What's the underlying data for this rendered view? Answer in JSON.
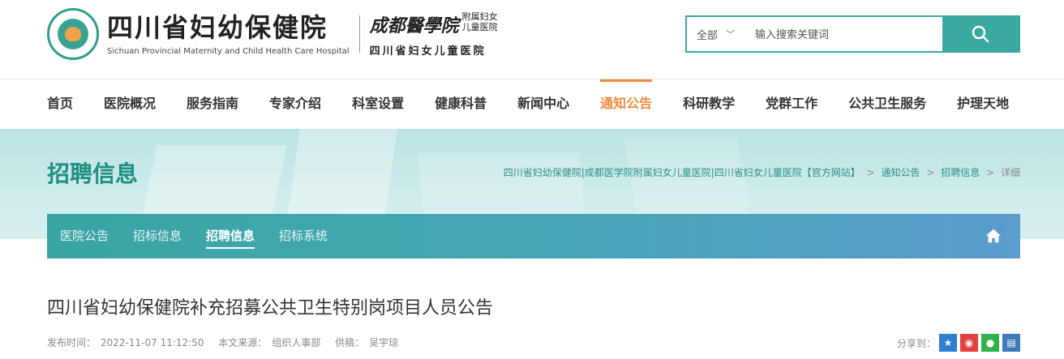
{
  "header": {
    "title_cn": "四川省妇幼保健院",
    "title_en": "Sichuan Provincial Maternity and Child Health Care Hospital",
    "affiliate_script": "成都醫學院",
    "affiliate_small_1": "附属妇女",
    "affiliate_small_2": "儿童医院",
    "affiliate_name": "四川省妇女儿童医院"
  },
  "search": {
    "scope": "全部",
    "placeholder": "输入搜索关键词"
  },
  "nav": {
    "items": [
      {
        "label": "首页"
      },
      {
        "label": "医院概况"
      },
      {
        "label": "服务指南"
      },
      {
        "label": "专家介绍"
      },
      {
        "label": "科室设置"
      },
      {
        "label": "健康科普"
      },
      {
        "label": "新闻中心"
      },
      {
        "label": "通知公告"
      },
      {
        "label": "科研教学"
      },
      {
        "label": "党群工作"
      },
      {
        "label": "公共卫生服务"
      },
      {
        "label": "护理天地"
      }
    ],
    "active": "通知公告"
  },
  "page": {
    "title": "招聘信息",
    "breadcrumb": {
      "site": "四川省妇幼保健院|成都医学院附属妇女儿童医院|四川省妇女儿童医院【官方网站】",
      "level1": "通知公告",
      "level2": "招聘信息",
      "current": "详细"
    }
  },
  "subnav": {
    "tabs": [
      {
        "label": "医院公告"
      },
      {
        "label": "招标信息"
      },
      {
        "label": "招聘信息"
      },
      {
        "label": "招标系统"
      }
    ],
    "active": "招聘信息"
  },
  "article": {
    "title": "四川省妇幼保健院补充招募公共卫生特别岗项目人员公告",
    "published_label": "发布时间：",
    "published": "2022-11-07 11:12:50",
    "source_label": "本文来源：",
    "source": "组织人事部",
    "author_label": "供稿：",
    "author": "吴宇琼",
    "share_label": "分享到："
  },
  "colors": {
    "accent": "#3aa9a0",
    "nav_active": "#f08a3c",
    "title_teal": "#1e8f83"
  }
}
